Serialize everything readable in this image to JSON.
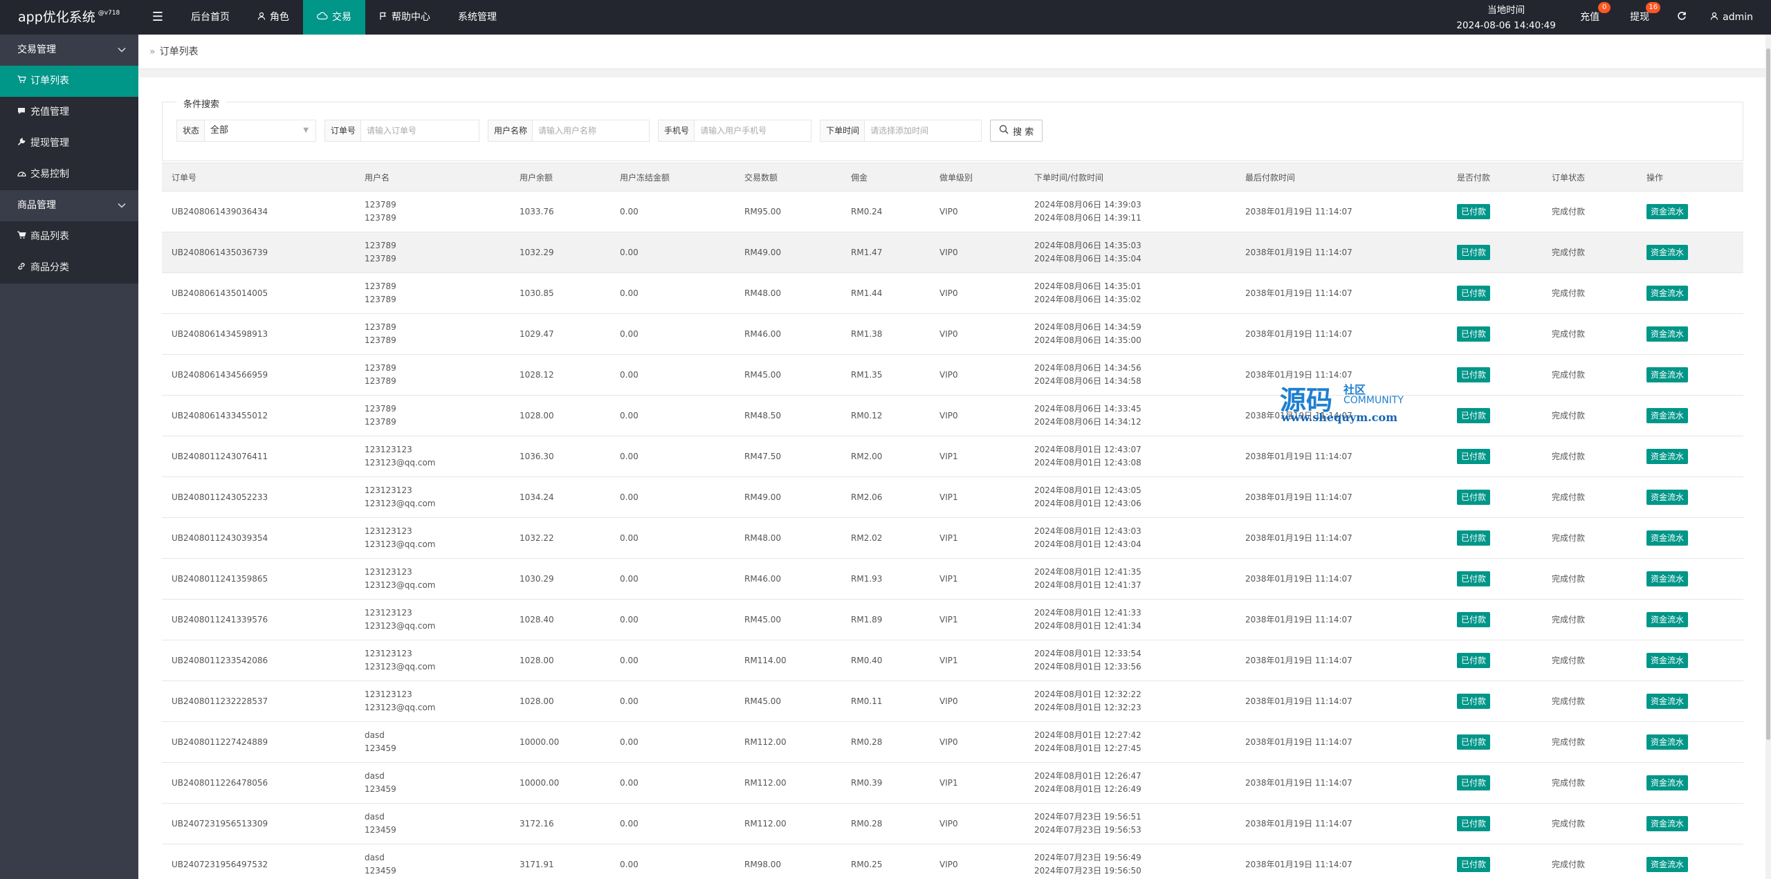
{
  "app": {
    "title": "app优化系统",
    "version": "@v718"
  },
  "nav": [
    {
      "label": "后台首页",
      "icon": ""
    },
    {
      "label": "角色",
      "icon": "user-icon"
    },
    {
      "label": "交易",
      "icon": "cloud-icon"
    },
    {
      "label": "帮助中心",
      "icon": "flag-icon"
    },
    {
      "label": "系统管理",
      "icon": ""
    }
  ],
  "header": {
    "time_label": "当地时间",
    "time_value": "2024-08-06 14:40:49",
    "recharge_label": "充值",
    "recharge_badge": "0",
    "withdraw_label": "提现",
    "withdraw_badge": "16",
    "user": "admin"
  },
  "sidebar": {
    "groups": [
      {
        "label": "交易管理",
        "items": [
          {
            "label": "订单列表",
            "icon": "cart-icon"
          },
          {
            "label": "充值管理",
            "icon": "comment-icon"
          },
          {
            "label": "提现管理",
            "icon": "wrench-icon"
          },
          {
            "label": "交易控制",
            "icon": "dashboard-icon"
          }
        ]
      },
      {
        "label": "商品管理",
        "items": [
          {
            "label": "商品列表",
            "icon": "cart-icon"
          },
          {
            "label": "商品分类",
            "icon": "link-icon"
          }
        ]
      }
    ]
  },
  "breadcrumb": "订单列表",
  "search": {
    "legend": "条件搜索",
    "status_label": "状态",
    "status_value": "全部",
    "order_label": "订单号",
    "order_placeholder": "请输入订单号",
    "username_label": "用户名称",
    "username_placeholder": "请输入用户名称",
    "phone_label": "手机号",
    "phone_placeholder": "请输入用户手机号",
    "time_label": "下单时间",
    "time_placeholder": "请选择添加时间",
    "button": "搜 索"
  },
  "table": {
    "columns": [
      "订单号",
      "用户名",
      "用户余额",
      "用户冻结金额",
      "交易数额",
      "佣金",
      "做单级别",
      "下单时间/付款时间",
      "最后付款时间",
      "是否付款",
      "订单状态",
      "操作"
    ],
    "rows": [
      {
        "order": "UB2408061439036434",
        "user1": "123789",
        "user2": "123789",
        "balance": "1033.76",
        "frozen": "0.00",
        "amount": "RM95.00",
        "commission": "RM0.24",
        "level": "VIP0",
        "time1": "2024年08月06日 14:39:03",
        "time2": "2024年08月06日 14:39:11",
        "last": "2038年01月19日 11:14:07",
        "paid": "已付款",
        "status": "完成付款",
        "action": "资金流水"
      },
      {
        "order": "UB2408061435036739",
        "user1": "123789",
        "user2": "123789",
        "balance": "1032.29",
        "frozen": "0.00",
        "amount": "RM49.00",
        "commission": "RM1.47",
        "level": "VIP0",
        "time1": "2024年08月06日 14:35:03",
        "time2": "2024年08月06日 14:35:04",
        "last": "2038年01月19日 11:14:07",
        "paid": "已付款",
        "status": "完成付款",
        "action": "资金流水"
      },
      {
        "order": "UB2408061435014005",
        "user1": "123789",
        "user2": "123789",
        "balance": "1030.85",
        "frozen": "0.00",
        "amount": "RM48.00",
        "commission": "RM1.44",
        "level": "VIP0",
        "time1": "2024年08月06日 14:35:01",
        "time2": "2024年08月06日 14:35:02",
        "last": "2038年01月19日 11:14:07",
        "paid": "已付款",
        "status": "完成付款",
        "action": "资金流水"
      },
      {
        "order": "UB2408061434598913",
        "user1": "123789",
        "user2": "123789",
        "balance": "1029.47",
        "frozen": "0.00",
        "amount": "RM46.00",
        "commission": "RM1.38",
        "level": "VIP0",
        "time1": "2024年08月06日 14:34:59",
        "time2": "2024年08月06日 14:35:00",
        "last": "2038年01月19日 11:14:07",
        "paid": "已付款",
        "status": "完成付款",
        "action": "资金流水"
      },
      {
        "order": "UB2408061434566959",
        "user1": "123789",
        "user2": "123789",
        "balance": "1028.12",
        "frozen": "0.00",
        "amount": "RM45.00",
        "commission": "RM1.35",
        "level": "VIP0",
        "time1": "2024年08月06日 14:34:56",
        "time2": "2024年08月06日 14:34:58",
        "last": "2038年01月19日 11:14:07",
        "paid": "已付款",
        "status": "完成付款",
        "action": "资金流水"
      },
      {
        "order": "UB2408061433455012",
        "user1": "123789",
        "user2": "123789",
        "balance": "1028.00",
        "frozen": "0.00",
        "amount": "RM48.50",
        "commission": "RM0.12",
        "level": "VIP0",
        "time1": "2024年08月06日 14:33:45",
        "time2": "2024年08月06日 14:34:12",
        "last": "2038年01月19日 11:14:07",
        "paid": "已付款",
        "status": "完成付款",
        "action": "资金流水"
      },
      {
        "order": "UB2408011243076411",
        "user1": "123123123",
        "user2": "123123@qq.com",
        "balance": "1036.30",
        "frozen": "0.00",
        "amount": "RM47.50",
        "commission": "RM2.00",
        "level": "VIP1",
        "time1": "2024年08月01日 12:43:07",
        "time2": "2024年08月01日 12:43:08",
        "last": "2038年01月19日 11:14:07",
        "paid": "已付款",
        "status": "完成付款",
        "action": "资金流水"
      },
      {
        "order": "UB2408011243052233",
        "user1": "123123123",
        "user2": "123123@qq.com",
        "balance": "1034.24",
        "frozen": "0.00",
        "amount": "RM49.00",
        "commission": "RM2.06",
        "level": "VIP1",
        "time1": "2024年08月01日 12:43:05",
        "time2": "2024年08月01日 12:43:06",
        "last": "2038年01月19日 11:14:07",
        "paid": "已付款",
        "status": "完成付款",
        "action": "资金流水"
      },
      {
        "order": "UB2408011243039354",
        "user1": "123123123",
        "user2": "123123@qq.com",
        "balance": "1032.22",
        "frozen": "0.00",
        "amount": "RM48.00",
        "commission": "RM2.02",
        "level": "VIP1",
        "time1": "2024年08月01日 12:43:03",
        "time2": "2024年08月01日 12:43:04",
        "last": "2038年01月19日 11:14:07",
        "paid": "已付款",
        "status": "完成付款",
        "action": "资金流水"
      },
      {
        "order": "UB2408011241359865",
        "user1": "123123123",
        "user2": "123123@qq.com",
        "balance": "1030.29",
        "frozen": "0.00",
        "amount": "RM46.00",
        "commission": "RM1.93",
        "level": "VIP1",
        "time1": "2024年08月01日 12:41:35",
        "time2": "2024年08月01日 12:41:37",
        "last": "2038年01月19日 11:14:07",
        "paid": "已付款",
        "status": "完成付款",
        "action": "资金流水"
      },
      {
        "order": "UB2408011241339576",
        "user1": "123123123",
        "user2": "123123@qq.com",
        "balance": "1028.40",
        "frozen": "0.00",
        "amount": "RM45.00",
        "commission": "RM1.89",
        "level": "VIP1",
        "time1": "2024年08月01日 12:41:33",
        "time2": "2024年08月01日 12:41:34",
        "last": "2038年01月19日 11:14:07",
        "paid": "已付款",
        "status": "完成付款",
        "action": "资金流水"
      },
      {
        "order": "UB2408011233542086",
        "user1": "123123123",
        "user2": "123123@qq.com",
        "balance": "1028.00",
        "frozen": "0.00",
        "amount": "RM114.00",
        "commission": "RM0.40",
        "level": "VIP1",
        "time1": "2024年08月01日 12:33:54",
        "time2": "2024年08月01日 12:33:56",
        "last": "2038年01月19日 11:14:07",
        "paid": "已付款",
        "status": "完成付款",
        "action": "资金流水"
      },
      {
        "order": "UB2408011232228537",
        "user1": "123123123",
        "user2": "123123@qq.com",
        "balance": "1028.00",
        "frozen": "0.00",
        "amount": "RM45.00",
        "commission": "RM0.11",
        "level": "VIP0",
        "time1": "2024年08月01日 12:32:22",
        "time2": "2024年08月01日 12:32:23",
        "last": "2038年01月19日 11:14:07",
        "paid": "已付款",
        "status": "完成付款",
        "action": "资金流水"
      },
      {
        "order": "UB2408011227424889",
        "user1": "dasd",
        "user2": "123459",
        "balance": "10000.00",
        "frozen": "0.00",
        "amount": "RM112.00",
        "commission": "RM0.28",
        "level": "VIP0",
        "time1": "2024年08月01日 12:27:42",
        "time2": "2024年08月01日 12:27:45",
        "last": "2038年01月19日 11:14:07",
        "paid": "已付款",
        "status": "完成付款",
        "action": "资金流水"
      },
      {
        "order": "UB2408011226478056",
        "user1": "dasd",
        "user2": "123459",
        "balance": "10000.00",
        "frozen": "0.00",
        "amount": "RM112.00",
        "commission": "RM0.39",
        "level": "VIP1",
        "time1": "2024年08月01日 12:26:47",
        "time2": "2024年08月01日 12:26:49",
        "last": "2038年01月19日 11:14:07",
        "paid": "已付款",
        "status": "完成付款",
        "action": "资金流水"
      },
      {
        "order": "UB2407231956513309",
        "user1": "dasd",
        "user2": "123459",
        "balance": "3172.16",
        "frozen": "0.00",
        "amount": "RM112.00",
        "commission": "RM0.28",
        "level": "VIP0",
        "time1": "2024年07月23日 19:56:51",
        "time2": "2024年07月23日 19:56:53",
        "last": "2038年01月19日 11:14:07",
        "paid": "已付款",
        "status": "完成付款",
        "action": "资金流水"
      },
      {
        "order": "UB2407231956497532",
        "user1": "dasd",
        "user2": "123459",
        "balance": "3171.91",
        "frozen": "0.00",
        "amount": "RM98.00",
        "commission": "RM0.25",
        "level": "VIP0",
        "time1": "2024年07月23日 19:56:49",
        "time2": "2024年07月23日 19:56:50",
        "last": "2038年01月19日 11:14:07",
        "paid": "已付款",
        "status": "完成付款",
        "action": "资金流水"
      }
    ]
  },
  "watermark": {
    "big": "源码",
    "small": "社区",
    "community": "COMMUNITY",
    "url": "www.shequym.com"
  },
  "colors": {
    "accent": "#009688",
    "header": "#23262e",
    "sidebar": "#393d49",
    "badge": "#ff5722"
  }
}
